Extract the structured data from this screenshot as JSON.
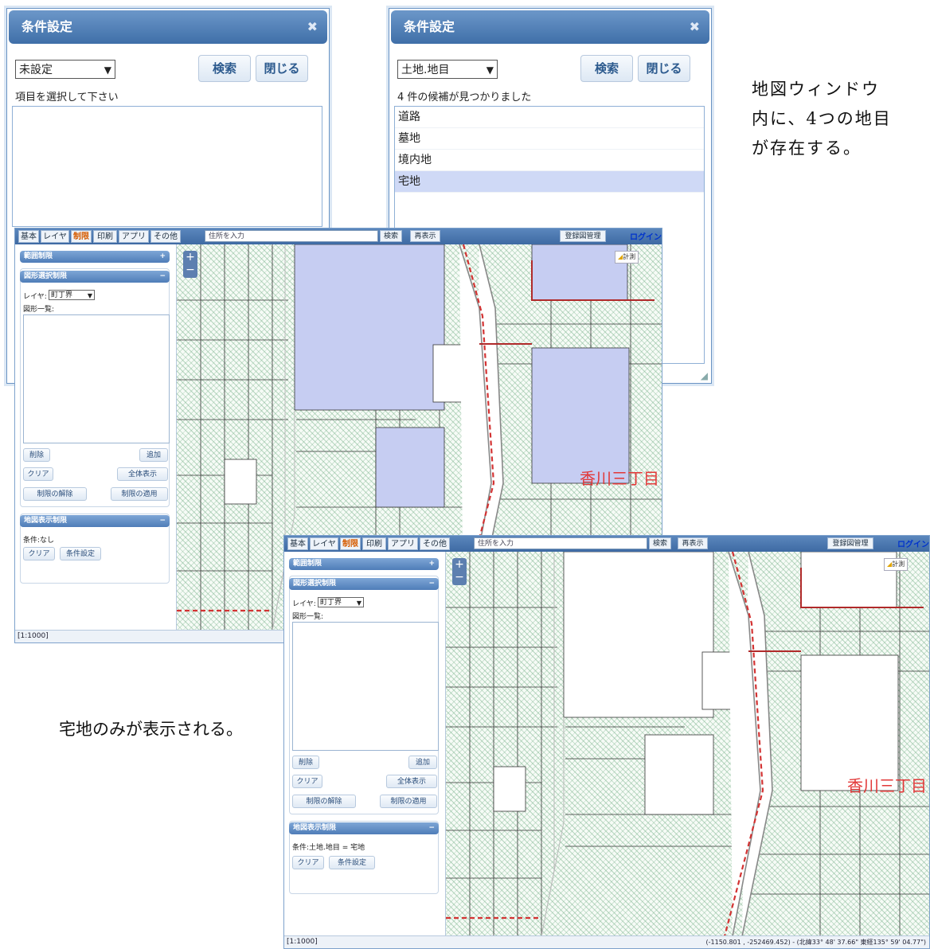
{
  "dialog_left": {
    "title": "条件設定",
    "select_value": "未設定",
    "search_label": "検索",
    "close_label": "閉じる",
    "message": "項目を選択して下さい",
    "items": []
  },
  "dialog_right": {
    "title": "条件設定",
    "select_value": "土地.地目",
    "search_label": "検索",
    "close_label": "閉じる",
    "message": "4 件の候補が見つかりました",
    "items": [
      {
        "label": "道路",
        "selected": false
      },
      {
        "label": "墓地",
        "selected": false
      },
      {
        "label": "境内地",
        "selected": false
      },
      {
        "label": "宅地",
        "selected": true
      }
    ]
  },
  "note_right": [
    "地図ウィンドウ",
    "内に、4つの地目",
    "が存在する。"
  ],
  "note_left": "宅地のみが表示される。",
  "app_before": {
    "tabs": [
      "基本",
      "レイヤ",
      "制限",
      "印刷",
      "アプリ",
      "その他"
    ],
    "active_tab": "制限",
    "address_placeholder": "住所を入力",
    "search_label": "検索",
    "redisplay_label": "再表示",
    "registered_label": "登録図管理",
    "login_label": "ログイン",
    "panel_range": "範囲制限",
    "panel_shape": "図形選択制限",
    "layer_label": "レイヤ:",
    "layer_value": "町丁界",
    "shape_list_label": "図形一覧:",
    "btn_delete": "削除",
    "btn_add": "追加",
    "btn_clear": "クリア",
    "btn_show_all": "全体表示",
    "btn_release": "制限の解除",
    "btn_apply": "制限の適用",
    "panel_map": "地図表示制限",
    "condition_text": "条件:なし",
    "btn_clear2": "クリア",
    "btn_condition": "条件設定",
    "measure_label": "計測",
    "district_label": "香川三丁目",
    "scale": "[1:1000]"
  },
  "app_after": {
    "tabs": [
      "基本",
      "レイヤ",
      "制限",
      "印刷",
      "アプリ",
      "その他"
    ],
    "active_tab": "制限",
    "address_placeholder": "住所を入力",
    "search_label": "検索",
    "redisplay_label": "再表示",
    "registered_label": "登録図管理",
    "login_label": "ログイン",
    "panel_range": "範囲制限",
    "panel_shape": "図形選択制限",
    "layer_label": "レイヤ:",
    "layer_value": "町丁界",
    "shape_list_label": "図形一覧:",
    "btn_delete": "削除",
    "btn_add": "追加",
    "btn_clear": "クリア",
    "btn_show_all": "全体表示",
    "btn_release": "制限の解除",
    "btn_apply": "制限の適用",
    "panel_map": "地図表示制限",
    "condition_text": "条件:土地.地目 = 宅地",
    "btn_clear2": "クリア",
    "btn_condition": "条件設定",
    "measure_label": "計測",
    "district_label": "香川三丁目",
    "scale": "[1:1000]",
    "coordinates": "(-1150.801 , -252469.452) - (北緯33° 48' 37.66\" 東経135° 59' 04.77\")"
  },
  "colors": {
    "header_blue": "#3f6fa8",
    "selected_row": "#cfd9f6",
    "residential_hatch": "#6aa87e",
    "temple_fill": "#c6cdf2",
    "road_red": "#d33333"
  }
}
